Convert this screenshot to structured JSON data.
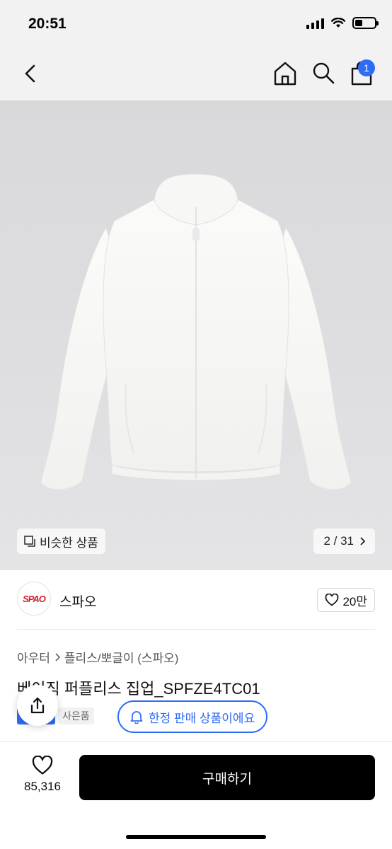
{
  "status_bar": {
    "time": "20:51"
  },
  "nav": {
    "icons": [
      "back-icon",
      "home-icon",
      "search-icon",
      "cart-icon"
    ],
    "cart_badge": "1"
  },
  "gallery": {
    "similar_label": "비슷한 상품",
    "counter": "2 / 31",
    "current_index": 2,
    "total": 31
  },
  "brand": {
    "logo_text": "SPAO",
    "name": "스파오",
    "likes": "20만"
  },
  "breadcrumb": {
    "category": "아우터",
    "subcategory": "플리스/뽀글이 (스파오)"
  },
  "product": {
    "title": "베이직 퍼플리스 집업_SPFZE4TC01",
    "gift_tag": "사은품",
    "limited_label": "한정 판매 상품이에요"
  },
  "bottom_bar": {
    "wish_count": "85,316",
    "buy_label": "구매하기"
  },
  "colors": {
    "accent": "#2e6cf6",
    "brand_red": "#d3202a",
    "buy_button": "#000000"
  }
}
